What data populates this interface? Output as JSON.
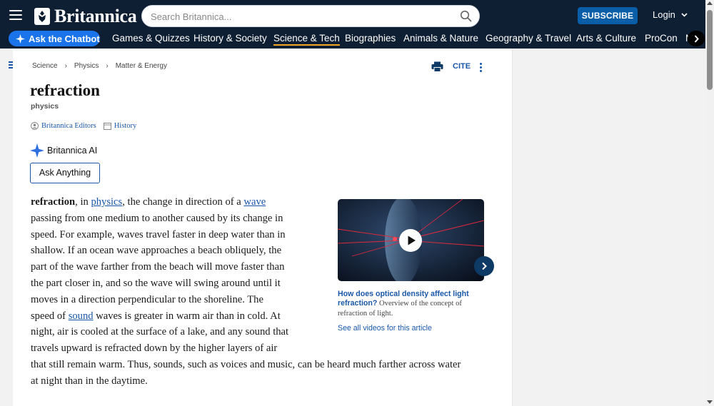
{
  "header": {
    "logo_text": "Britannica",
    "search_placeholder": "Search Britannica...",
    "subscribe_label": "SUBSCRIBE",
    "login_label": "Login"
  },
  "nav": {
    "chatbot_label": "Ask the Chatbot",
    "items": [
      {
        "label": "Games & Quizzes"
      },
      {
        "label": "History & Society"
      },
      {
        "label": "Science & Tech"
      },
      {
        "label": "Biographies"
      },
      {
        "label": "Animals & Nature"
      },
      {
        "label": "Geography & Travel"
      },
      {
        "label": "Arts & Culture"
      },
      {
        "label": "ProCon"
      },
      {
        "label": "M"
      }
    ],
    "active": "Science & Tech"
  },
  "breadcrumb": [
    "Science",
    "Physics",
    "Matter & Energy"
  ],
  "toolbar": {
    "cite_label": "CITE"
  },
  "article": {
    "title": "refraction",
    "subtitle": "physics",
    "author_label": "Britannica Editors",
    "history_label": "History",
    "ai_label": "Britannica AI",
    "ask_label": "Ask Anything",
    "body": {
      "l1_bold": "refraction",
      "l1_a": ", in ",
      "l1_link1": "physics",
      "l1_b": ", the change in direction of a ",
      "l1_link2": "wave",
      "l2": "passing from one medium to another caused by its change in",
      "l3": "speed. For example, waves travel faster in deep water than in",
      "l4": "shallow. If an ocean wave approaches a beach obliquely, the",
      "l5": "part of the wave farther from the beach will move faster than",
      "l6": "the part closer in, and so the wave will swing around until it",
      "l7": "moves in a direction perpendicular to the shoreline. The",
      "l8_a": "speed of ",
      "l8_link": "sound",
      "l8_b": " waves is greater in warm air than in cold. At",
      "l9": "night, air is cooled at the surface of a lake, and any sound that",
      "l10": "travels upward is refracted down by the higher layers of air",
      "l11": "that still remain warm. Thus, sounds, such as voices and music, can be heard much farther across water",
      "l12": "at night than in the daytime."
    }
  },
  "video": {
    "title": "How does optical density affect light refraction?",
    "description": " Overview of the concept of refraction of light.",
    "see_all": "See all videos for this article"
  },
  "colors": {
    "header_bg": "#0e1f33",
    "accent_blue": "#1a57a8",
    "chatbot_blue": "#1a73e8",
    "subscribe_blue": "#0a5ea8",
    "active_underline": "#f5a623"
  }
}
